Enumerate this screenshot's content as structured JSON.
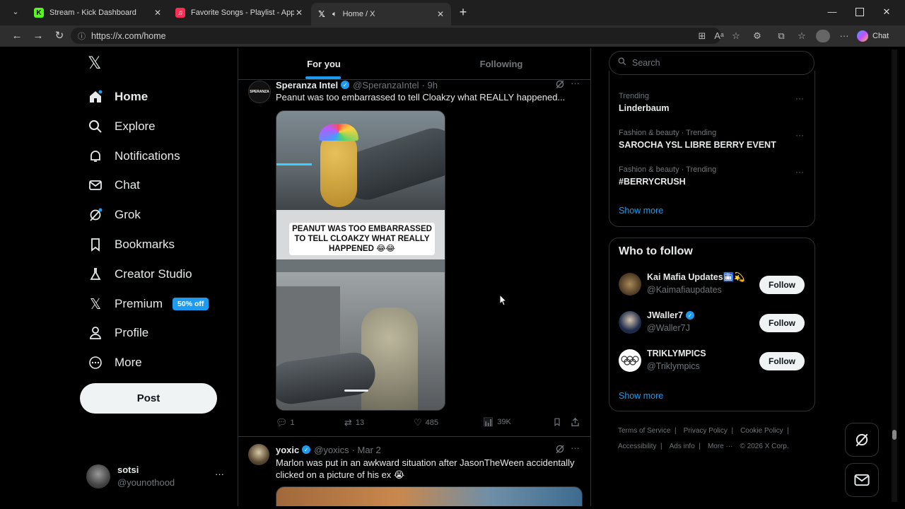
{
  "browser": {
    "tabs": [
      {
        "title": "Stream - Kick Dashboard",
        "icon": "kick-icon"
      },
      {
        "title": "Favorite Songs - Playlist - Apple M",
        "icon": "apple-music-icon"
      },
      {
        "title": "Home / X",
        "icon": "x-icon"
      }
    ],
    "url": "https://x.com/home",
    "chat_label": "Chat"
  },
  "sidebar": {
    "items": [
      {
        "label": "Home",
        "icon": "home-icon"
      },
      {
        "label": "Explore",
        "icon": "search-icon"
      },
      {
        "label": "Notifications",
        "icon": "bell-icon"
      },
      {
        "label": "Chat",
        "icon": "mail-icon"
      },
      {
        "label": "Grok",
        "icon": "grok-icon"
      },
      {
        "label": "Bookmarks",
        "icon": "bookmark-icon"
      },
      {
        "label": "Creator Studio",
        "icon": "flask-icon"
      },
      {
        "label": "Premium",
        "icon": "x-icon"
      },
      {
        "label": "Profile",
        "icon": "person-icon"
      },
      {
        "label": "More",
        "icon": "more-circle-icon"
      }
    ],
    "premium_badge": "50% off",
    "post_label": "Post",
    "account": {
      "name": "sotsi",
      "handle": "@younothood"
    }
  },
  "feed": {
    "tabs": [
      "For you",
      "Following"
    ],
    "tweets": [
      {
        "name": "Speranza Intel",
        "handle": "@SperanzaIntel",
        "time": "· 9h",
        "text": "Peanut was too embarrassed to tell Cloakzy what REALLY happened...",
        "media_caption": "PEANUT WAS TOO EMBARRASSED TO TELL CLOAKZY WHAT REALLY HAPPENED 😂😂",
        "replies": "1",
        "reposts": "13",
        "likes": "485",
        "views": "39K"
      },
      {
        "name": "yoxic",
        "handle": "@yoxics",
        "time": "· Mar 2",
        "text": "Marlon was put in an awkward situation after JasonTheWeen accidentally clicked on a picture of his ex 😭"
      }
    ]
  },
  "right": {
    "search_placeholder": "Search",
    "trends": [
      {
        "category": "Trending",
        "name": "Linderbaum"
      },
      {
        "category": "Fashion & beauty · Trending",
        "name": "SAROCHA YSL LIBRE BERRY EVENT"
      },
      {
        "category": "Fashion & beauty · Trending",
        "name": "#BERRYCRUSH"
      }
    ],
    "show_more": "Show more",
    "who_to_follow_title": "Who to follow",
    "follow_suggestions": [
      {
        "name": "Kai Mafia Updates🛅💫",
        "handle": "@Kaimafiaupdates"
      },
      {
        "name": "JWaller7",
        "handle": "@Waller7J"
      },
      {
        "name": "TRIKLYMPICS",
        "handle": "@Triklympics"
      }
    ],
    "follow_label": "Follow",
    "footer": [
      "Terms of Service",
      "Privacy Policy",
      "Cookie Policy",
      "Accessibility",
      "Ads info",
      "More ···",
      "© 2026 X Corp."
    ]
  }
}
